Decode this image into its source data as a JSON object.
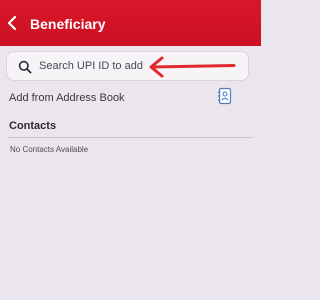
{
  "header": {
    "title": "Beneficiary",
    "back_icon": "chevron-left-icon",
    "background_color": "#d8182a"
  },
  "search": {
    "placeholder": "Search UPI ID to add",
    "icon": "search-icon"
  },
  "annotation": {
    "icon": "arrow-left-icon",
    "color": "#e0292d"
  },
  "address_book": {
    "label": "Add from Address Book",
    "icon": "address-book-icon",
    "icon_color": "#4a7fc1"
  },
  "contacts": {
    "heading": "Contacts",
    "empty_message": "No Contacts Available"
  }
}
